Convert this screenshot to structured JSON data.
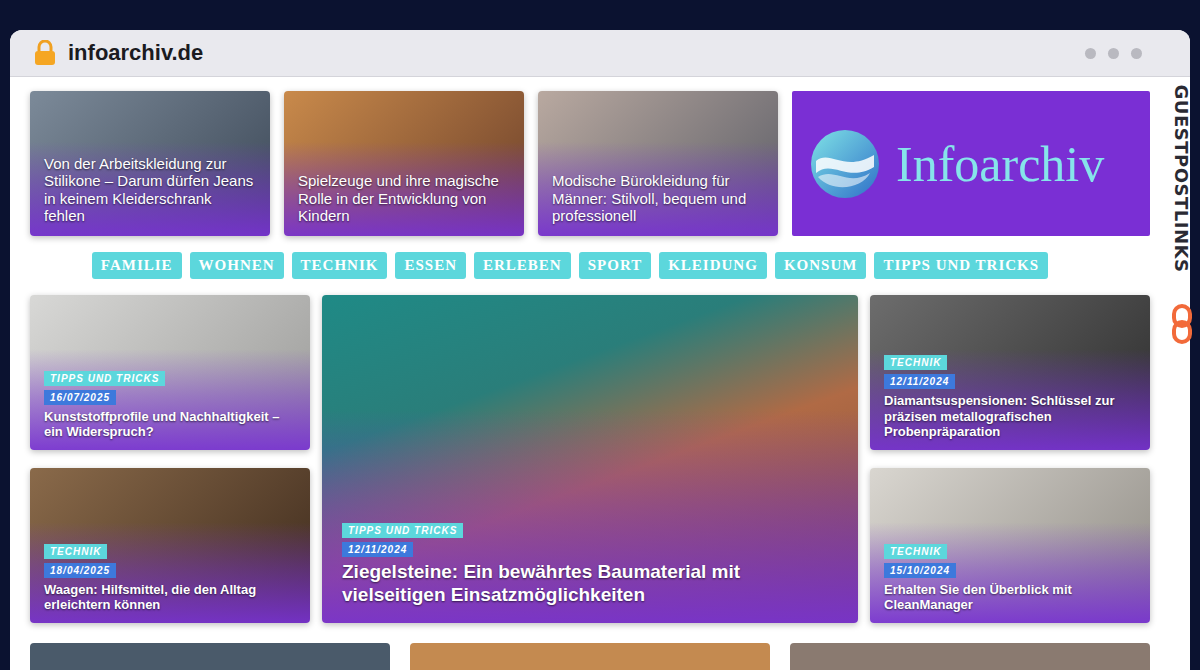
{
  "browser": {
    "address": "infoarchiv.de"
  },
  "top_cards": [
    {
      "title": "Von der Arbeitskleidung zur Stilikone – Darum dürfen Jeans in keinem Kleiderschrank fehlen"
    },
    {
      "title": "Spielzeuge und ihre magische Rolle in der Entwicklung von Kindern"
    },
    {
      "title": "Modische Bürokleidung für Männer: Stilvoll, bequem und professionell"
    }
  ],
  "logo": {
    "text": "Infoarchiv"
  },
  "nav": [
    {
      "label": "FAMILIE"
    },
    {
      "label": "WOHNEN"
    },
    {
      "label": "TECHNIK"
    },
    {
      "label": "ESSEN"
    },
    {
      "label": "ERLEBEN"
    },
    {
      "label": "SPORT"
    },
    {
      "label": "KLEIDUNG"
    },
    {
      "label": "KONSUM"
    },
    {
      "label": "TIPPS UND TRICKS"
    }
  ],
  "articles": {
    "left": [
      {
        "category": "TIPPS UND TRICKS",
        "date": "16/07/2025",
        "title": "Kunststoffprofile und Nachhaltigkeit – ein Widerspruch?"
      },
      {
        "category": "TECHNIK",
        "date": "18/04/2025",
        "title": "Waagen: Hilfsmittel, die den Alltag erleichtern können"
      }
    ],
    "featured": {
      "category": "TIPPS UND TRICKS",
      "date": "12/11/2024",
      "title": "Ziegelsteine: Ein bewährtes Baumaterial mit vielseitigen Einsatzmöglichkeiten"
    },
    "right": [
      {
        "category": "TECHNIK",
        "date": "12/11/2024",
        "title": "Diamantsuspensionen: Schlüssel zur präzisen metallografischen Probenpräparation"
      },
      {
        "category": "TECHNIK",
        "date": "15/10/2024",
        "title": "Erhalten Sie den Überblick mit CleanManager"
      }
    ]
  },
  "watermark": {
    "text": "GUESTPOSTLINKS"
  }
}
